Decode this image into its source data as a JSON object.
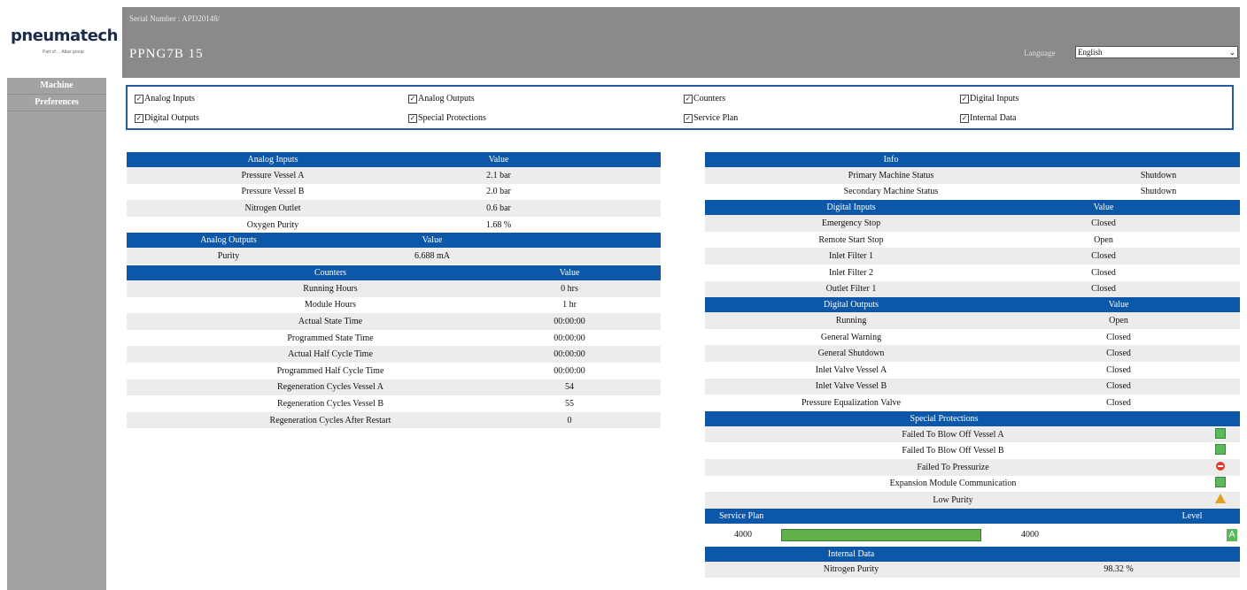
{
  "brand": {
    "name": "pneumatech",
    "tagline": "Part of ... Atlas group"
  },
  "header": {
    "serial": "Serial Number : APD20148/",
    "model": "PPNG7B  15",
    "language_label": "Language",
    "language_value": "English"
  },
  "sidebar": {
    "items": [
      {
        "label": "Machine"
      },
      {
        "label": "Preferences"
      }
    ]
  },
  "filters": [
    {
      "label": "Analog Inputs",
      "checked": true
    },
    {
      "label": "Analog Outputs",
      "checked": true
    },
    {
      "label": "Counters",
      "checked": true
    },
    {
      "label": "Digital Inputs",
      "checked": true
    },
    {
      "label": "Digital Outputs",
      "checked": true
    },
    {
      "label": "Special Protections",
      "checked": true
    },
    {
      "label": "Service Plan",
      "checked": true
    },
    {
      "label": "Internal Data",
      "checked": true
    }
  ],
  "analog_inputs": {
    "header": "Analog Inputs",
    "value_header": "Value",
    "rows": [
      {
        "name": "Pressure Vessel A",
        "value": "2.1 bar"
      },
      {
        "name": "Pressure Vessel B",
        "value": "2.0 bar"
      },
      {
        "name": "Nitrogen Outlet",
        "value": "0.6 bar"
      },
      {
        "name": "Oxygen Purity",
        "value": "1.68 %"
      }
    ]
  },
  "analog_outputs": {
    "header": "Analog Outputs",
    "value_header": "Value",
    "rows": [
      {
        "name": "Purity",
        "value": "6.688 mA"
      }
    ]
  },
  "counters": {
    "header": "Counters",
    "value_header": "Value",
    "rows": [
      {
        "name": "Running Hours",
        "value": "0 hrs"
      },
      {
        "name": "Module Hours",
        "value": "1 hr"
      },
      {
        "name": "Actual State Time",
        "value": "00:00:00"
      },
      {
        "name": "Programmed State Time",
        "value": "00:00:00"
      },
      {
        "name": "Actual Half Cycle Time",
        "value": "00:00:00"
      },
      {
        "name": "Programmed Half Cycle Time",
        "value": "00:00:00"
      },
      {
        "name": "Regeneration Cycles Vessel A",
        "value": "54"
      },
      {
        "name": "Regeneration Cycles Vessel B",
        "value": "55"
      },
      {
        "name": "Regeneration Cycles After Restart",
        "value": "0"
      }
    ]
  },
  "info": {
    "header": "Info",
    "rows": [
      {
        "name": "Primary Machine Status",
        "value": "Shutdown"
      },
      {
        "name": "Secondary Machine Status",
        "value": "Shutdown"
      }
    ]
  },
  "digital_inputs": {
    "header": "Digital Inputs",
    "value_header": "Value",
    "rows": [
      {
        "name": "Emergency Stop",
        "value": "Closed"
      },
      {
        "name": "Remote Start Stop",
        "value": "Open"
      },
      {
        "name": "Inlet Filter 1",
        "value": "Closed"
      },
      {
        "name": "Inlet Filter 2",
        "value": "Closed"
      },
      {
        "name": "Outlet Filter 1",
        "value": "Closed"
      }
    ]
  },
  "digital_outputs": {
    "header": "Digital Outputs",
    "value_header": "Value",
    "rows": [
      {
        "name": "Running",
        "value": "Open"
      },
      {
        "name": "General Warning",
        "value": "Closed"
      },
      {
        "name": "General Shutdown",
        "value": "Closed"
      },
      {
        "name": "Inlet Valve Vessel A",
        "value": "Closed"
      },
      {
        "name": "Inlet Valve Vessel B",
        "value": "Closed"
      },
      {
        "name": "Pressure Equalization Valve",
        "value": "Closed"
      }
    ]
  },
  "special_protections": {
    "header": "Special Protections",
    "rows": [
      {
        "name": "Failed To Blow Off Vessel A",
        "status": "ok"
      },
      {
        "name": "Failed To Blow Off Vessel B",
        "status": "ok"
      },
      {
        "name": "Failed To Pressurize",
        "status": "shutdown"
      },
      {
        "name": "Expansion Module Communication",
        "status": "ok"
      },
      {
        "name": "Low Purity",
        "status": "warning"
      }
    ]
  },
  "service_plan": {
    "header": "Service Plan",
    "level_header": "Level",
    "start": "4000",
    "end": "4000",
    "progress_percent": 100,
    "level": "A"
  },
  "internal_data": {
    "header": "Internal Data",
    "rows": [
      {
        "name": "Nitrogen Purity",
        "value": "98.32 %"
      }
    ]
  },
  "colors": {
    "header_blue": "#0d57a8",
    "header_gray": "#8a8a8a",
    "sidebar_gray": "#a3a3a3",
    "ok_green": "#5cb85c",
    "stop_red": "#e23b2e",
    "warn_orange": "#e0a020"
  }
}
